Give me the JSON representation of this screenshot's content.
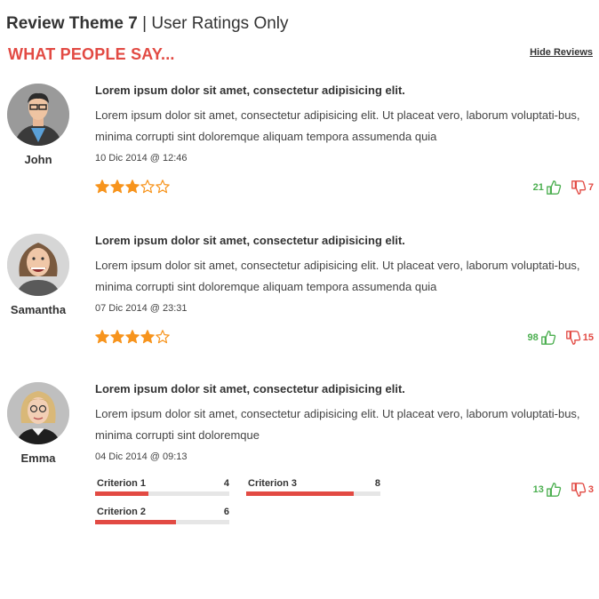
{
  "header": {
    "theme_name": "Review Theme 7",
    "separator": "|",
    "subtitle": "User Ratings Only"
  },
  "section": {
    "title": "WHAT PEOPLE SAY...",
    "hide_label": "Hide Reviews"
  },
  "colors": {
    "accent_red": "#e24a43",
    "star_orange": "#f7941d",
    "like_green": "#4caf50"
  },
  "rating_scale": 5,
  "criterion_scale": 10,
  "reviews": [
    {
      "name": "John",
      "title": "Lorem ipsum dolor sit amet, consectetur adipisicing elit.",
      "text": "Lorem ipsum dolor sit amet, consectetur adipisicing elit. Ut placeat vero, laborum voluptati-bus, minima corrupti sint doloremque aliquam tempora assumenda quia",
      "date": "10 Dic 2014 @ 12:46",
      "rating": 3,
      "likes": "21",
      "dislikes": "7",
      "avatar_icon": "man-avatar-icon"
    },
    {
      "name": "Samantha",
      "title": "Lorem ipsum dolor sit amet, consectetur adipisicing elit.",
      "text": "Lorem ipsum dolor sit amet, consectetur adipisicing elit. Ut placeat vero, laborum voluptati-bus, minima corrupti sint doloremque aliquam tempora assumenda quia",
      "date": "07 Dic 2014 @ 23:31",
      "rating": 4,
      "likes": "98",
      "dislikes": "15",
      "avatar_icon": "woman-avatar-icon"
    },
    {
      "name": "Emma",
      "title": "Lorem ipsum dolor sit amet, consectetur adipisicing elit.",
      "text": "Lorem ipsum dolor sit amet, consectetur adipisicing elit. Ut placeat vero, laborum voluptati-bus, minima corrupti sint doloremque",
      "date": "04 Dic 2014 @ 09:13",
      "likes": "13",
      "dislikes": "3",
      "avatar_icon": "woman-avatar-icon",
      "criteria": [
        {
          "label": "Criterion 1",
          "value": 4
        },
        {
          "label": "Criterion 2",
          "value": 6
        },
        {
          "label": "Criterion 3",
          "value": 8
        }
      ]
    }
  ]
}
